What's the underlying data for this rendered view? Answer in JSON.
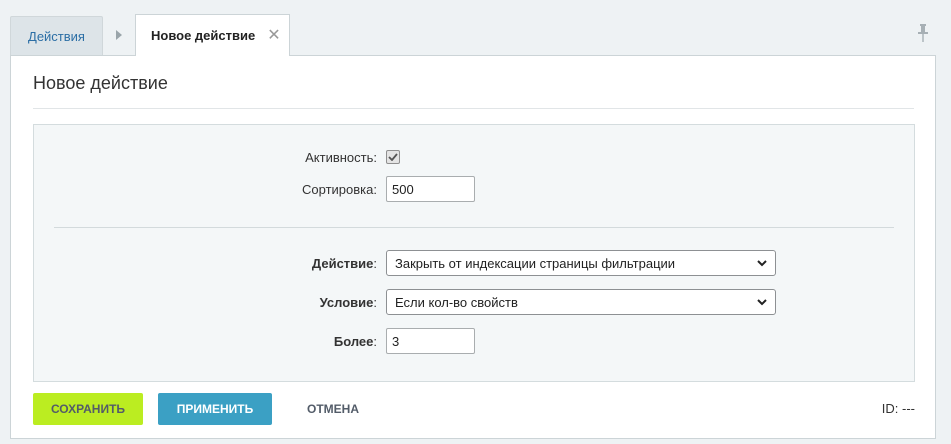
{
  "tabs": {
    "parent_label": "Действия",
    "active_label": "Новое действие",
    "close_glyph": "✕"
  },
  "page": {
    "title": "Новое действие"
  },
  "form": {
    "activity_label": "Активность:",
    "activity_checked": true,
    "sort_label": "Сортировка:",
    "sort_value": "500",
    "action_label": "Действие",
    "action_colon": ":",
    "action_value": "Закрыть от индексации страницы фильтрации",
    "condition_label": "Условие",
    "condition_colon": ":",
    "condition_value": "Если кол-во свойств",
    "more_label": "Более",
    "more_colon": ":",
    "more_value": "3"
  },
  "footer": {
    "save_label": "СОХРАНИТЬ",
    "apply_label": "ПРИМЕНИТЬ",
    "cancel_label": "ОТМЕНА",
    "id_text": "ID: ---"
  },
  "icons": {
    "tab_arrow": "triangle-right-icon",
    "pin": "pin-icon",
    "select_chevron": "chevron-down-icon",
    "checkbox": "checkmark-icon"
  },
  "colors": {
    "save_button": "#bbed21",
    "apply_button": "#3ba0c4",
    "tab_link": "#2b6ea5"
  }
}
